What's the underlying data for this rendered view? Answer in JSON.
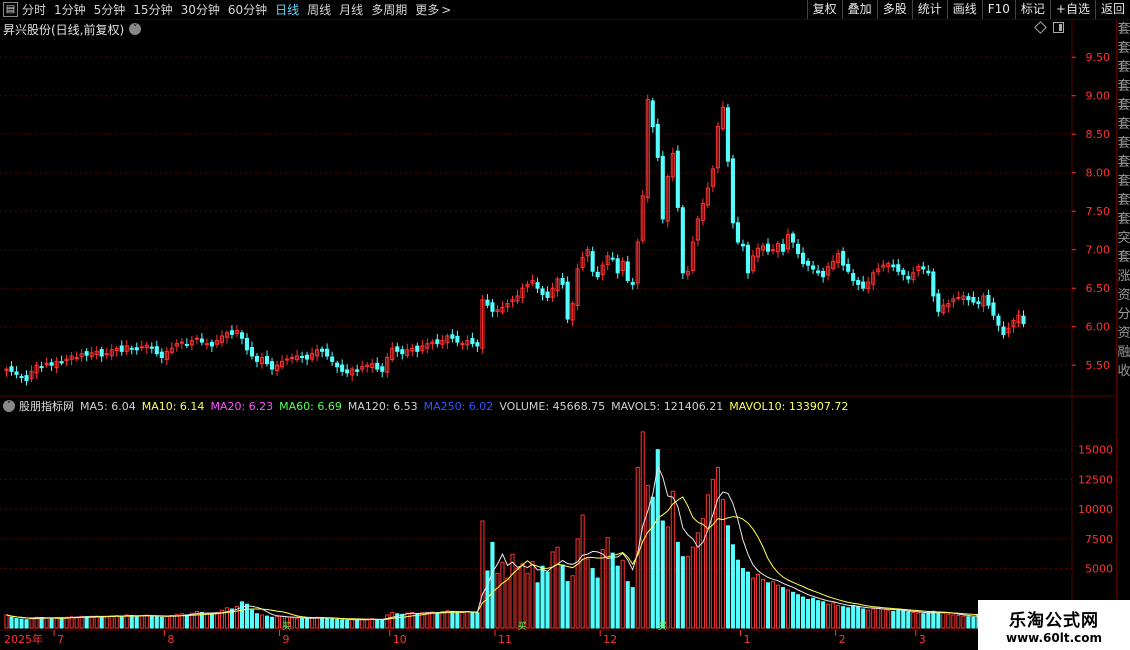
{
  "toolbar": {
    "periods": [
      {
        "label": "分时",
        "active": false
      },
      {
        "label": "1分钟",
        "active": false
      },
      {
        "label": "5分钟",
        "active": false
      },
      {
        "label": "15分钟",
        "active": false
      },
      {
        "label": "30分钟",
        "active": false
      },
      {
        "label": "60分钟",
        "active": false
      },
      {
        "label": "日线",
        "active": true
      },
      {
        "label": "周线",
        "active": false
      },
      {
        "label": "月线",
        "active": false
      },
      {
        "label": "多周期",
        "active": false
      },
      {
        "label": "更多",
        "active": false
      }
    ],
    "more_arrow": ">",
    "buttons": [
      "复权",
      "叠加",
      "多股",
      "统计",
      "画线",
      "F10",
      "标记",
      "+自选",
      "返回"
    ]
  },
  "stock_title": "昇兴股份(日线,前复权)",
  "indicator": {
    "name": "股朋指标网",
    "values": [
      {
        "label": "MA5: 6.04",
        "color": "#d0d0d0"
      },
      {
        "label": "MA10: 6.14",
        "color": "#ffff55"
      },
      {
        "label": "MA20: 6.23",
        "color": "#ff55ff"
      },
      {
        "label": "MA60: 6.69",
        "color": "#55ff55"
      },
      {
        "label": "MA120: 6.53",
        "color": "#d0d0d0"
      },
      {
        "label": "MA250: 6.02",
        "color": "#3355ff"
      },
      {
        "label": "VOLUME: 45668.75",
        "color": "#d0d0d0"
      },
      {
        "label": "MAVOL5: 121406.21",
        "color": "#d0d0d0"
      },
      {
        "label": "MAVOL10: 133907.72",
        "color": "#ffff55"
      }
    ]
  },
  "price_axis": [
    "9.50",
    "9.00",
    "8.50",
    "8.00",
    "7.50",
    "7.00",
    "6.50",
    "6.00",
    "5.50"
  ],
  "volume_axis": [
    "15000",
    "12500",
    "10000",
    "7500",
    "5000"
  ],
  "date_axis": [
    "2025年",
    "7",
    "8",
    "9",
    "10",
    "11",
    "12",
    "1",
    "2",
    "3"
  ],
  "signal_marks": [
    "买",
    "买",
    "买"
  ],
  "sidebar_chars": [
    "套",
    "套",
    "套",
    "套",
    "套",
    "套",
    "套",
    "套",
    "套",
    "套",
    "套",
    "突",
    "套",
    "涨",
    "资",
    "分",
    "资",
    "融",
    "收"
  ],
  "watermark": {
    "name": "乐淘公式网",
    "url": "www.60lt.com"
  },
  "colors": {
    "up": "#ff3232",
    "down": "#54ffff",
    "grid": "#5a0000",
    "axis_text": "#ff3232"
  },
  "chart_data": {
    "type": "candlestick",
    "price_range": [
      5.1,
      9.75
    ],
    "volume_range": [
      0,
      18000
    ],
    "month_labels": [
      "7",
      "8",
      "9",
      "10",
      "11",
      "12",
      "1",
      "2",
      "3"
    ],
    "closes": [
      5.45,
      5.42,
      5.38,
      5.35,
      5.3,
      5.42,
      5.5,
      5.48,
      5.52,
      5.5,
      5.55,
      5.53,
      5.58,
      5.62,
      5.6,
      5.65,
      5.63,
      5.66,
      5.68,
      5.62,
      5.65,
      5.7,
      5.72,
      5.68,
      5.75,
      5.72,
      5.7,
      5.74,
      5.76,
      5.72,
      5.65,
      5.6,
      5.68,
      5.72,
      5.78,
      5.8,
      5.76,
      5.82,
      5.85,
      5.8,
      5.78,
      5.75,
      5.82,
      5.88,
      5.92,
      5.9,
      5.95,
      5.85,
      5.7,
      5.62,
      5.55,
      5.6,
      5.52,
      5.45,
      5.5,
      5.55,
      5.58,
      5.6,
      5.62,
      5.6,
      5.58,
      5.65,
      5.7,
      5.68,
      5.62,
      5.55,
      5.48,
      5.42,
      5.4,
      5.45,
      5.42,
      5.48,
      5.5,
      5.52,
      5.45,
      5.42,
      5.6,
      5.72,
      5.68,
      5.65,
      5.7,
      5.72,
      5.68,
      5.75,
      5.78,
      5.8,
      5.78,
      5.82,
      5.88,
      5.85,
      5.8,
      5.78,
      5.82,
      5.78,
      5.75,
      6.35,
      6.28,
      6.2,
      6.22,
      6.25,
      6.3,
      6.35,
      6.4,
      6.5,
      6.55,
      6.6,
      6.5,
      6.42,
      6.38,
      6.5,
      6.62,
      6.55,
      6.1,
      6.3,
      6.75,
      6.9,
      7.0,
      6.72,
      6.65,
      6.8,
      6.92,
      6.88,
      6.7,
      6.85,
      6.6,
      6.55,
      7.1,
      7.7,
      8.95,
      8.6,
      8.2,
      7.4,
      7.95,
      8.25,
      7.55,
      6.7,
      6.72,
      7.1,
      7.4,
      7.6,
      7.8,
      8.05,
      8.6,
      8.85,
      8.15,
      7.35,
      7.1,
      7.05,
      6.7,
      6.92,
      7.02,
      7.05,
      6.98,
      7.0,
      7.08,
      6.98,
      7.2,
      7.1,
      6.95,
      6.82,
      6.8,
      6.75,
      6.7,
      6.65,
      6.78,
      6.85,
      6.95,
      6.8,
      6.72,
      6.6,
      6.55,
      6.5,
      6.58,
      6.7,
      6.75,
      6.8,
      6.82,
      6.78,
      6.72,
      6.68,
      6.62,
      6.7,
      6.78,
      6.75,
      6.7,
      6.4,
      6.2,
      6.28,
      6.3,
      6.36,
      6.38,
      6.4,
      6.35,
      6.32,
      6.3,
      6.4,
      6.28,
      6.15,
      6.02,
      5.9,
      5.98,
      6.08,
      6.15,
      6.04
    ],
    "volumes": [
      1100,
      900,
      800,
      750,
      700,
      820,
      900,
      880,
      850,
      800,
      880,
      860,
      900,
      950,
      920,
      980,
      960,
      990,
      1000,
      950,
      980,
      1020,
      1050,
      990,
      1100,
      1050,
      1000,
      1040,
      1080,
      1020,
      950,
      900,
      980,
      1050,
      1120,
      1200,
      1100,
      1250,
      1400,
      1300,
      1200,
      1150,
      1300,
      1500,
      1700,
      1600,
      1800,
      2200,
      2000,
      1500,
      1200,
      1100,
      1000,
      900,
      950,
      980,
      900,
      850,
      820,
      800,
      780,
      850,
      900,
      880,
      820,
      780,
      720,
      680,
      650,
      700,
      680,
      720,
      760,
      780,
      700,
      650,
      1100,
      1300,
      1200,
      1150,
      1250,
      1300,
      1200,
      1280,
      1320,
      1350,
      1300,
      1380,
      1450,
      1400,
      1350,
      1300,
      1380,
      1300,
      1280,
      9000,
      4800,
      7200,
      4600,
      5500,
      4200,
      6200,
      5000,
      5400,
      4600,
      5600,
      3800,
      5200,
      4700,
      6400,
      6800,
      5300,
      3900,
      4400,
      7500,
      9500,
      5800,
      5000,
      4200,
      6600,
      7600,
      6300,
      5200,
      5700,
      3900,
      3400,
      13500,
      16500,
      12000,
      11000,
      15000,
      9000,
      8500,
      11500,
      7200,
      6000,
      6000,
      6800,
      8000,
      9200,
      11200,
      12500,
      13500,
      10800,
      8600,
      7000,
      5700,
      5000,
      4700,
      4200,
      4500,
      4100,
      3800,
      3900,
      3600,
      3400,
      3200,
      3000,
      2800,
      2600,
      2400,
      2500,
      2300,
      2200,
      2000,
      2100,
      1900,
      1800,
      1700,
      1900,
      1800,
      1600,
      1500,
      1600,
      1700,
      1600,
      1500,
      1400,
      1500,
      1450,
      1350,
      1300,
      1250,
      1200,
      1300,
      1400,
      1350,
      1250,
      1150,
      1100,
      1050,
      1000,
      950,
      900,
      1150,
      1050,
      1000,
      980,
      950,
      920,
      900,
      880,
      860,
      850
    ]
  }
}
